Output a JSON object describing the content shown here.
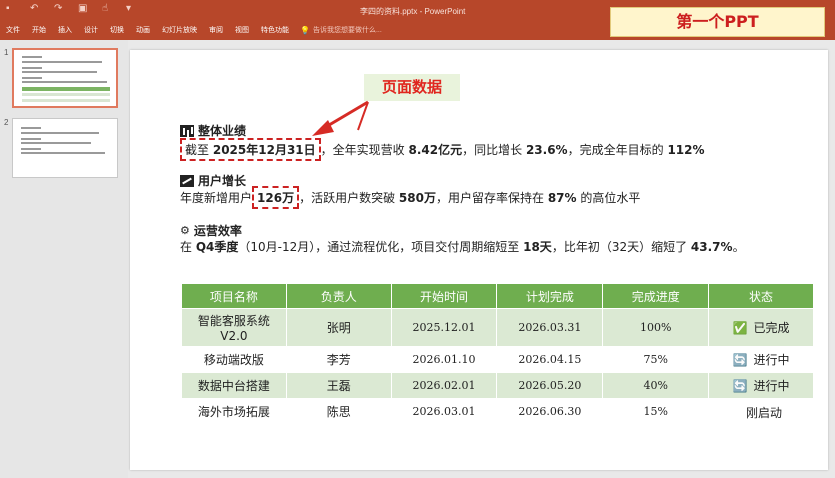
{
  "window": {
    "title": "李四的资料.pptx - PowerPoint",
    "menu": [
      "文件",
      "开始",
      "插入",
      "设计",
      "切换",
      "动画",
      "幻灯片放映",
      "审阅",
      "视图",
      "特色功能"
    ],
    "tell_me": "告诉我您想要做什么..."
  },
  "badge": "第一个PPT",
  "callout": "页面数据",
  "thumbnails": {
    "numbers": [
      "1",
      "2"
    ]
  },
  "slide": {
    "overall": {
      "heading": "整体业绩",
      "prefix": "截至",
      "date": "2025年12月31日",
      "text1": "，全年实现营收",
      "revenue": "8.42亿元",
      "text2": "，同比增长",
      "growth": "23.6%",
      "text3": "，完成全年目标的",
      "target": "112%"
    },
    "users": {
      "heading": "用户增长",
      "prefix": "年度新增用户",
      "new_users": "126万",
      "text1": "，活跃用户数突破",
      "active": "580万",
      "text2": "，用户留存率保持在",
      "retention": "87%",
      "text3": "的高位水平"
    },
    "ops": {
      "heading": "运营效率",
      "prefix": "在",
      "quarter": "Q4季度",
      "text1": "（10月-12月），通过流程优化，项目交付周期缩短至",
      "days": "18天",
      "text2": "，比年初（32天）缩短了",
      "pct": "43.7%",
      "text3": "。"
    },
    "table": {
      "headers": [
        "项目名称",
        "负责人",
        "开始时间",
        "计划完成",
        "完成进度",
        "状态"
      ],
      "rows": [
        {
          "name": "智能客服系统V2.0",
          "owner": "张明",
          "start": "2025.12.01",
          "end": "2026.03.31",
          "progress": "100%",
          "status_icon": "✅",
          "status": "已完成"
        },
        {
          "name": "移动端改版",
          "owner": "李芳",
          "start": "2026.01.10",
          "end": "2026.04.15",
          "progress": "75%",
          "status_icon": "🔄",
          "status": "进行中"
        },
        {
          "name": "数据中台搭建",
          "owner": "王磊",
          "start": "2026.02.01",
          "end": "2026.05.20",
          "progress": "40%",
          "status_icon": "🔄",
          "status": "进行中"
        },
        {
          "name": "海外市场拓展",
          "owner": "陈思",
          "start": "2026.03.01",
          "end": "2026.06.30",
          "progress": "15%",
          "status_icon": "",
          "status": "刚启动"
        }
      ]
    }
  },
  "colors": {
    "ribbon": "#b7472a",
    "table_header": "#6fae4f",
    "table_stripe": "#dbe9d3",
    "highlight": "#cc2222"
  }
}
